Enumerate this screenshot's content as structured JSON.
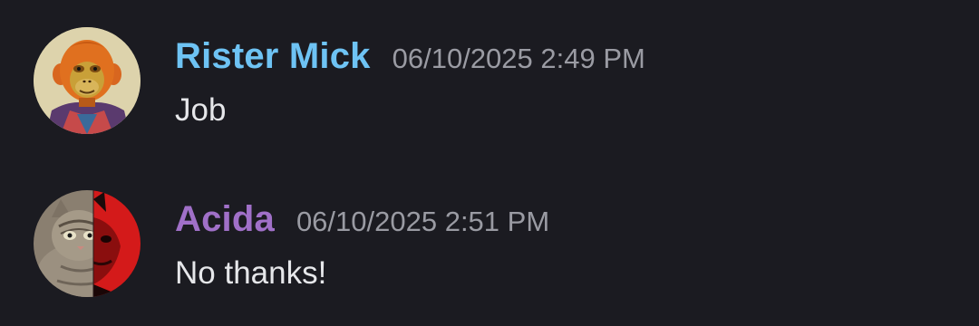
{
  "messages": [
    {
      "username": "Rister Mick",
      "username_color": "#6ec3f4",
      "timestamp": "06/10/2025 2:49 PM",
      "text": "Job",
      "avatar_icon": "orange-ape-avatar"
    },
    {
      "username": "Acida",
      "username_color": "#a070c8",
      "timestamp": "06/10/2025 2:51 PM",
      "text": "No thanks!",
      "avatar_icon": "cat-demon-split-avatar"
    }
  ]
}
